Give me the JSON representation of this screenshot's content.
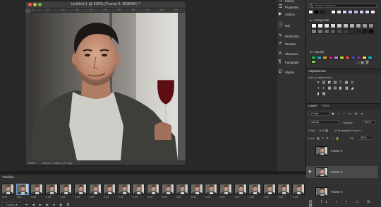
{
  "document": {
    "title": "Untitled-1 @ 200% (Frame 2, RGB/8#) *",
    "zoom": "200%",
    "doc_info": "540 px x 540 px (72 ppi)",
    "ruler_ticks": [
      "0",
      "50",
      "100",
      "150",
      "200",
      "250",
      "300",
      "350",
      "400",
      "450",
      "500"
    ]
  },
  "side_panels": [
    {
      "label": "History",
      "icon": "history-icon"
    },
    {
      "label": "Properties",
      "icon": "properties-icon"
    },
    {
      "label": "Actions",
      "icon": "play-icon"
    },
    {
      "label": "Info",
      "icon": "info-icon"
    },
    {
      "label": "Brush Sett...",
      "icon": "brush-settings-icon"
    },
    {
      "label": "Brushes",
      "icon": "brushes-icon"
    },
    {
      "label": "Character",
      "icon": "character-icon"
    },
    {
      "label": "Paragraph",
      "icon": "paragraph-icon"
    },
    {
      "label": "Glyphs",
      "icon": "glyphs-icon"
    }
  ],
  "swatches": {
    "search_placeholder": "Search Swatches",
    "groups": [
      "Grayscale",
      "spotify"
    ],
    "top_colors": [
      "#ffffff",
      "#000000",
      "#1a1a1a",
      "#333333",
      "#ffffff",
      "#e6e6e6",
      "#d6d6ff",
      "#c8c8f0",
      "#b8b8e8",
      "#d0d0ff",
      "#e0e0ff",
      "#f0f0ff"
    ],
    "grayscale": [
      "#ffffff",
      "#f2f2f2",
      "#e6e6e6",
      "#d9d9d9",
      "#cccccc",
      "#bfbfbf",
      "#b3b3b3",
      "#a6a6a6",
      "#999999",
      "#8c8c8c",
      "#808080",
      "#737373",
      "#666666",
      "#595959",
      "#4d4d4d",
      "#404040",
      "#333333",
      "#262626",
      "#1a1a1a",
      "#0d0d0d"
    ],
    "spotify": [
      "#1db954",
      "#2ab4c9",
      "#f59b23",
      "#e91e63",
      "#b388ff",
      "#cddc39",
      "#ff5722",
      "#3f51b5",
      "#9c27b0",
      "#ffeb3b",
      "#00bcd4",
      "#8bc34a"
    ]
  },
  "adjustments": {
    "title": "Adjustments",
    "subtitle": "Add an adjustment"
  },
  "layers": {
    "tabs": [
      "Layers",
      "Paths"
    ],
    "kind_label": "Kind",
    "blend_mode": "Normal",
    "opacity_label": "Opacity:",
    "opacity_value": "100%",
    "unify_label": "Unify:",
    "propagate_label": "Propagate Frame 1",
    "lock_label": "Lock:",
    "fill_label": "Fill:",
    "fill_value": "100%",
    "rows": [
      {
        "name": "Frame 3",
        "active": false,
        "visible": false
      },
      {
        "name": "Frame 2",
        "active": true,
        "visible": true
      },
      {
        "name": "Frame 0",
        "active": false,
        "visible": false
      }
    ]
  },
  "timeline": {
    "title": "Timeline",
    "loop_option": "Forever",
    "frame_duration": "0.05",
    "frame_count": 21,
    "selected_frame": 2
  }
}
